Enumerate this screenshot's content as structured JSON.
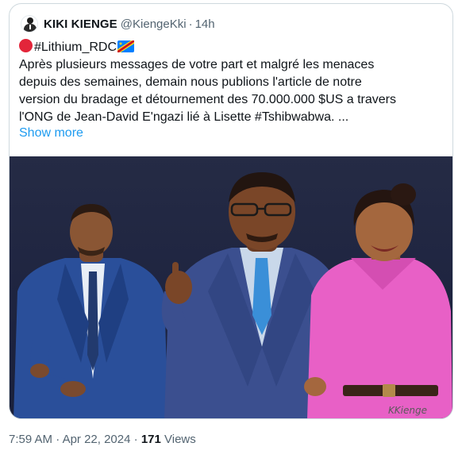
{
  "quote": {
    "author_name": "KIKI KIENGE",
    "handle": "@KiengeKki",
    "separator": "·",
    "time_ago": "14h",
    "text_lines": [
      "#Lithium_RDC",
      "Après plusieurs messages de votre part et malgré les menaces",
      "depuis des semaines, demain nous publions l'article de notre",
      "version du bradage et détournement des 70.000.000 $US a travers",
      "l'ONG de Jean-David E'ngazi lié à Lisette #Tshibwabwa. ..."
    ],
    "show_more": "Show more",
    "media": {
      "watermark": "KKienge",
      "description_icons": [
        "red-circle-icon",
        "drc-flag-icon"
      ]
    }
  },
  "meta": {
    "time": "7:59 AM",
    "dot": "·",
    "date": "Apr 22, 2024",
    "dot2": "·",
    "views_count": "171",
    "views_label": "Views"
  },
  "colors": {
    "link": "#1d9bf0",
    "secondary_text": "#536471",
    "border": "#cfd9de",
    "drc_blue": "#007fff",
    "drc_red": "#ce1021",
    "drc_yellow": "#f7d618"
  }
}
